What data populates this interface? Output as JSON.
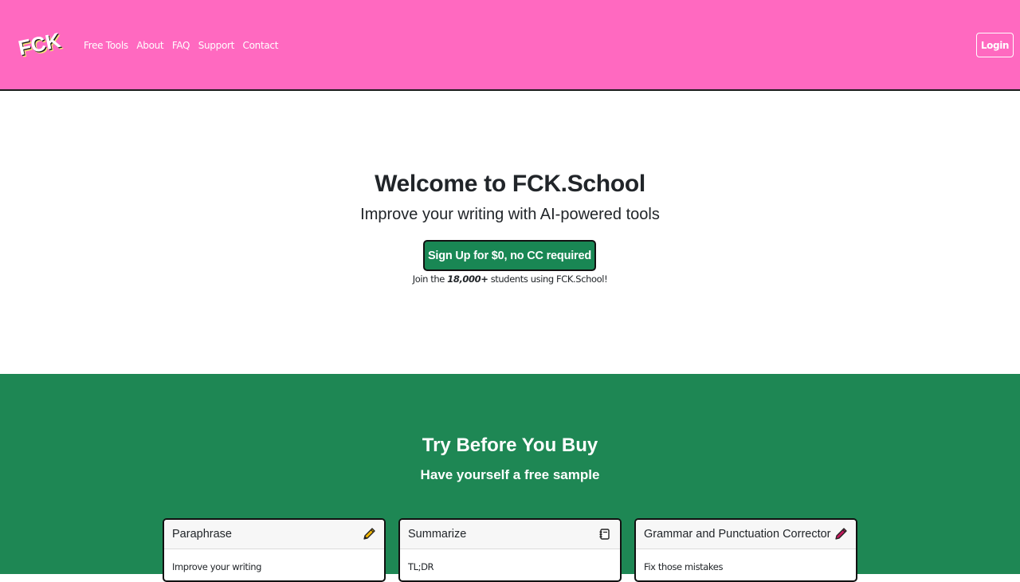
{
  "header": {
    "logo_text": "FCK",
    "nav": [
      "Free Tools",
      "About",
      "FAQ",
      "Support",
      "Contact"
    ],
    "login_label": "Login"
  },
  "hero": {
    "title": "Welcome to FCK.School",
    "subtitle": "Improve your writing with AI-powered tools",
    "signup_label": "Sign Up for $0, no CC required",
    "join_prefix": "Join the",
    "join_count": "18,000+",
    "join_suffix": "students using FCK.School!"
  },
  "samples": {
    "title": "Try Before You Buy",
    "subtitle": "Have yourself a free sample",
    "cards": [
      {
        "title": "Paraphrase",
        "body": "Improve your writing",
        "icon": "pencil-icon"
      },
      {
        "title": "Summarize",
        "body": "TL;DR",
        "icon": "journal-icon"
      },
      {
        "title": "Grammar and Punctuation Corrector",
        "body": "Fix those mistakes",
        "icon": "pen-icon"
      }
    ]
  },
  "colors": {
    "header_bg": "#ff69c0",
    "primary_green": "#198754",
    "section_green": "#1e8754",
    "pencil_yellow": "#f2b705",
    "pen_red": "#c2185b"
  }
}
